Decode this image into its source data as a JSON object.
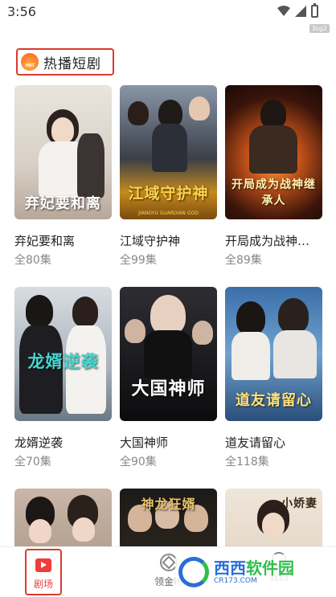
{
  "status_bar": {
    "time": "3:56"
  },
  "watermark_small": "3sg2",
  "section": {
    "title": "热播短剧",
    "badge": "HOT"
  },
  "cards": [
    {
      "title": "弃妃要和离",
      "count": "全80集",
      "poster_text": "弃妃要和离"
    },
    {
      "title": "江域守护神",
      "count": "全99集",
      "poster_text": "江域守护神",
      "poster_sub": "JIANGYU GUARDIAN GOD"
    },
    {
      "title": "开局成为战神…",
      "count": "全89集",
      "poster_text": "开局成为战神继承人"
    },
    {
      "title": "龙婿逆袭",
      "count": "全70集",
      "poster_text": "龙婿逆袭"
    },
    {
      "title": "大国神师",
      "count": "全90集",
      "poster_text": "大国神师"
    },
    {
      "title": "道友请留心",
      "count": "全118集",
      "poster_text": "道友请留心"
    },
    {
      "title": "",
      "count": "",
      "poster_text": ""
    },
    {
      "title": "",
      "count": "",
      "poster_text": "神龙狂婿"
    },
    {
      "title": "",
      "count": "",
      "poster_text": "小娇妻"
    }
  ],
  "bottom_nav": {
    "drama_label": "剧场",
    "coins_label": "领金币",
    "me_label": "我的"
  },
  "site_watermark": {
    "main_a": "西西",
    "main_b": "软件园",
    "url": "CR173.COM"
  },
  "colors": {
    "accent": "#f03c3c",
    "highlight_border": "#d93b2d"
  }
}
